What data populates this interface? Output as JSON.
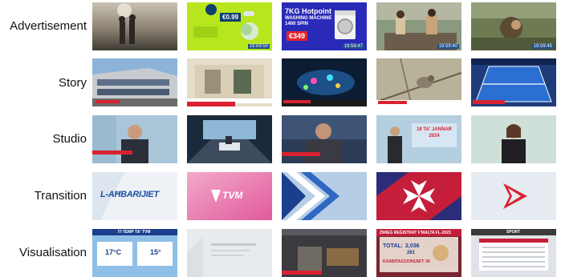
{
  "rows": [
    {
      "label": "Advertisement",
      "color": "#d9d9d9"
    },
    {
      "label": "Story"
    },
    {
      "label": "Studio"
    },
    {
      "label": "Transition"
    },
    {
      "label": "Visualisation"
    }
  ],
  "advertisement": {
    "t2_price": "€0.99",
    "t2_time": "19:59:50",
    "t3_line1": "7KG Hotpoint",
    "t3_line2": "WASHING MACHINE",
    "t3_line3": "1400 SPIN",
    "t3_price": "€349",
    "t3_time": "19:59:47",
    "t4_time": "19:59:40",
    "t5_time": "19:59:45"
  },
  "transition": {
    "t1_logo": "L-AĦBARIJIET",
    "t2_logo": "TVM"
  },
  "studio": {
    "t4_date": "18 TA' JANNAR 2024"
  },
  "visualisation": {
    "t1_header": "IT-TEMP TA' TVM",
    "t1_temp1": "17°C",
    "t1_temp2": "15°",
    "t5_header": "SPORT",
    "t4_title": "ŻWIEĠ REĠISTRAT F'MALTA FL-2023",
    "t4_total_label": "TOTAL:",
    "t4_total": "2,036",
    "t4_sub": "261",
    "t4_koab": "KOABITAZZJONIJIET: 36"
  }
}
